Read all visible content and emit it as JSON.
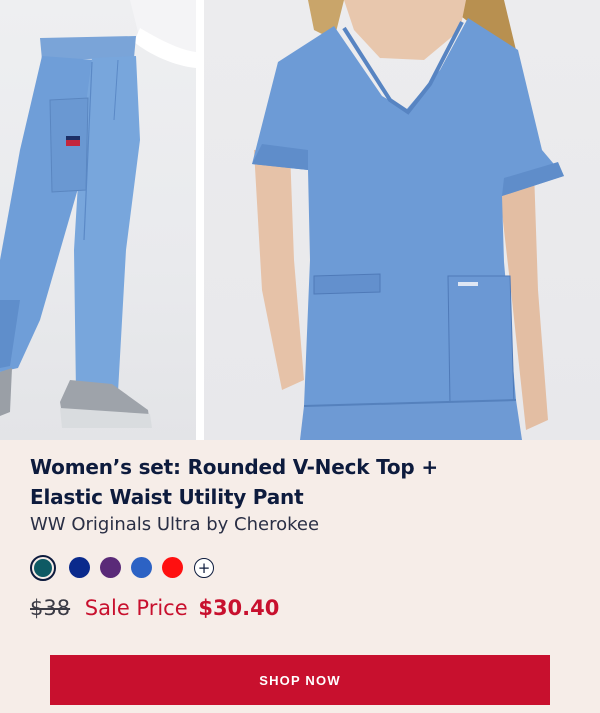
{
  "product": {
    "title_line1": "Women’s set: Rounded V-Neck Top +",
    "title_line2": "Elastic Waist Utility Pant",
    "brand_line": "WW Originals Ultra by Cherokee"
  },
  "colors": {
    "swatches": [
      "#0e5a64",
      "#0a2a8c",
      "#5a2a78",
      "#2c62c4",
      "#ff1010"
    ],
    "selected_index": 0,
    "more_symbol": "+",
    "accent": "#c8102e",
    "text_primary": "#0d1b3d",
    "background": "#f6ede8"
  },
  "price": {
    "original": "$38",
    "sale_label": "Sale Price",
    "sale_value": "$30.40"
  },
  "cta": {
    "label": "SHOP NOW"
  },
  "images": {
    "left": "pants-photo",
    "right": "top-photo",
    "garment_color": "#6d9bd6"
  }
}
